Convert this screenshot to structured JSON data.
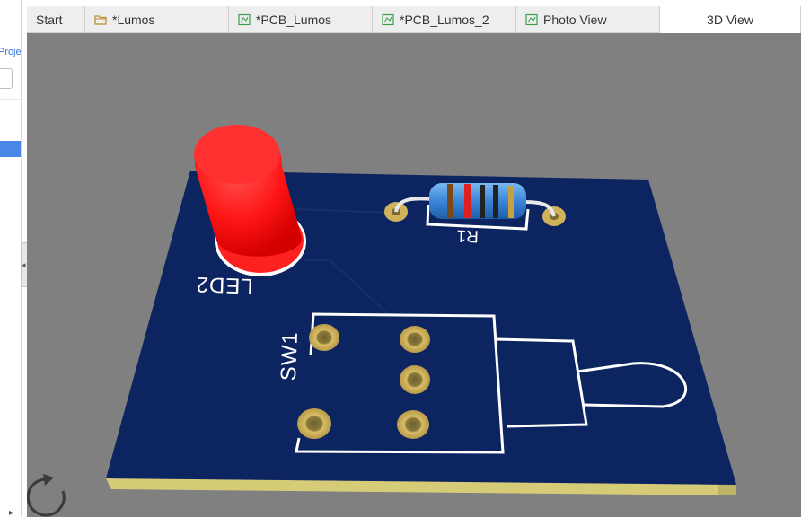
{
  "sidebar": {
    "projects_link": "Projects"
  },
  "tabs": [
    {
      "label": "Start",
      "icon": "",
      "active": false
    },
    {
      "label": "*Lumos",
      "icon": "folder-icon",
      "active": false
    },
    {
      "label": "*PCB_Lumos",
      "icon": "pcb-icon",
      "active": false
    },
    {
      "label": "*PCB_Lumos_2",
      "icon": "pcb-icon",
      "active": false
    },
    {
      "label": "Photo View",
      "icon": "pcb-icon",
      "active": false
    },
    {
      "label": "3D View",
      "icon": "",
      "active": true
    }
  ],
  "board": {
    "silkscreen": {
      "led": "LED2",
      "resistor": "R1",
      "switch": "SW1"
    },
    "colors": {
      "background": "#808080",
      "board": "#0c2460",
      "board_edge": "#d6cc78",
      "led": "#ff1a1a",
      "pad": "#c8a850",
      "silkscreen": "#ffffff",
      "resistor_body": "#3a86d8"
    }
  },
  "controls": {
    "rotate_icon": "rotate-icon"
  }
}
